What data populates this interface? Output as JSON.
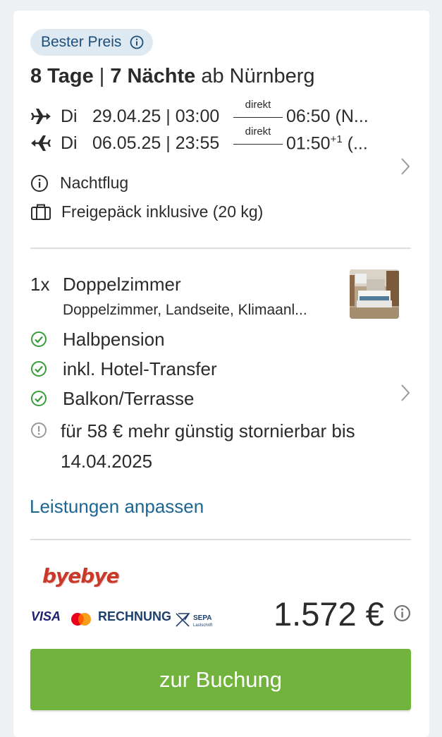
{
  "badge": {
    "label": "Bester Preis",
    "icon": "info-icon"
  },
  "trip": {
    "duration": "8 Tage",
    "separator": " | ",
    "nights": "7 Nächte",
    "origin": " ab Nürnberg"
  },
  "flights": [
    {
      "icon": "plane-departure-icon",
      "day": "Di",
      "datetime": "29.04.25 | 03:00",
      "direct": "direkt",
      "arrival": "06:50 (N...",
      "arrival_sup": ""
    },
    {
      "icon": "plane-return-icon",
      "day": "Di",
      "datetime": "06.05.25 | 23:55",
      "direct": "direkt",
      "arrival": "01:50",
      "arrival_sup": "+1",
      "arrival_suffix": " (..."
    }
  ],
  "flight_notes": [
    {
      "icon": "info-icon",
      "text": "Nachtflug"
    },
    {
      "icon": "luggage-icon",
      "text": "Freigepäck inklusive (20 kg)"
    }
  ],
  "room": {
    "qty": "1x",
    "name": "Doppelzimmer",
    "description": "Doppelzimmer, Landseite, Klimaanl..."
  },
  "features": [
    {
      "icon": "check-circle-icon",
      "text": "Halbpension"
    },
    {
      "icon": "check-circle-icon",
      "text": "inkl. Hotel-Transfer"
    },
    {
      "icon": "check-circle-icon",
      "text": "Balkon/Terrasse"
    }
  ],
  "cancellation": {
    "icon": "exclamation-circle-icon",
    "text": "für 58 € mehr günstig stornierbar bis 14.04.2025"
  },
  "customize_link": "Leistungen anpassen",
  "operator": {
    "logo_text": "byebye"
  },
  "payment": {
    "visa": "VISA",
    "invoice": "RECHNUNG",
    "sepa_top": "SEPA",
    "sepa_bottom": "Lastschrift"
  },
  "price": {
    "amount": "1.572 €"
  },
  "cta": {
    "label": "zur Buchung"
  },
  "colors": {
    "accent_green": "#71b33c",
    "link_blue": "#1d6592",
    "badge_bg": "#dfe9f1",
    "check_green": "#3a9b3a"
  }
}
